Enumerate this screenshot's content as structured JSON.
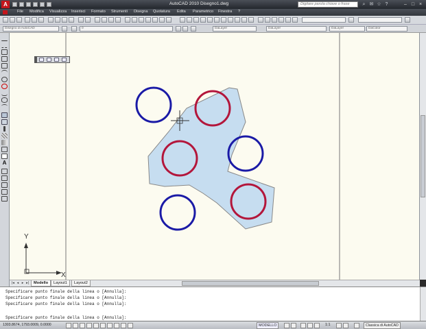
{
  "titlebar": {
    "title": "AutoCAD 2010    Disegno1.dwg",
    "search_placeholder": "Digitare parola chiave o frase"
  },
  "menus": [
    "File",
    "Modifica",
    "Visualizza",
    "Inserisci",
    "Formato",
    "Strumenti",
    "Disegna",
    "Quotatura",
    "Edita",
    "Parametrico",
    "Finestra",
    "?"
  ],
  "toolbar": {
    "workspace_combo": "Disegno di AutoCAD",
    "layer_combo": "0",
    "color_combo": "DaLayer",
    "linetype_combo": "DaLayer",
    "lineweight_combo": "DaLayer",
    "plotstyle_combo": "DaColor"
  },
  "canvas": {
    "blue_circle_color": "#1a1aa6",
    "red_circle_color": "#b3163b",
    "region_fill": "#c6ddf0",
    "ucs": {
      "y_label": "Y",
      "x_label": "X"
    }
  },
  "tabs": [
    "Modello",
    "Layout1",
    "Layout2"
  ],
  "active_tab": "Modello",
  "command_history": [
    "Specificare punto finale della linea o [Annulla]:",
    "Specificare punto finale della linea o [Annulla]:",
    "Specificare punto finale della linea o [Annulla]:",
    "",
    "Specificare punto finale della linea o [Annulla]:"
  ],
  "statusbar": {
    "coordinates": "1303.8674, 1793.0009, 0.0000",
    "space": "MODELLO",
    "scale": "1:1",
    "workspace": "Classica di AutoCAD"
  }
}
